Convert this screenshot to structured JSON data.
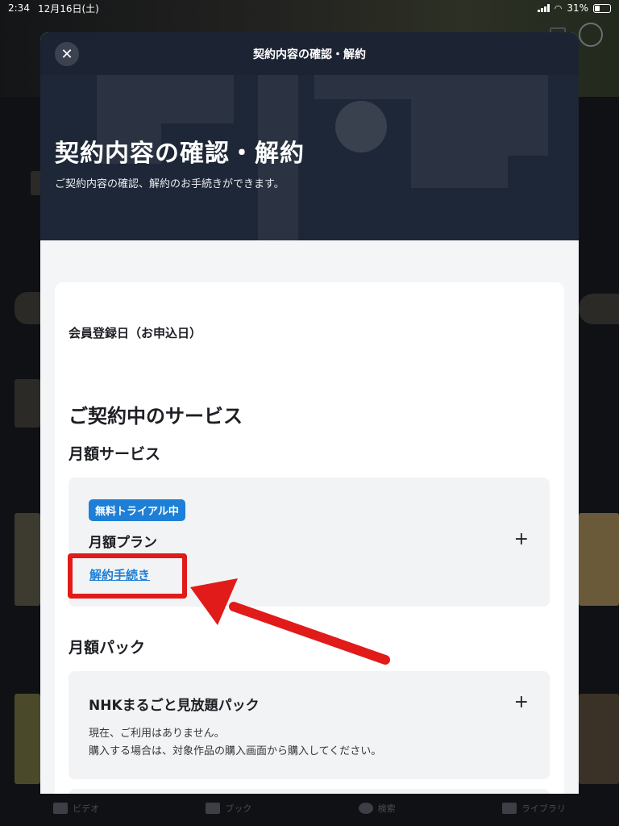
{
  "status_bar": {
    "time": "2:34",
    "date": "12月16日(土)",
    "battery": "31%"
  },
  "modal": {
    "header_title": "契約内容の確認・解約",
    "close_icon": "close-icon",
    "hero_title": "契約内容の確認・解約",
    "hero_subtitle": "ご契約内容の確認、解約のお手続きができます。",
    "member_registration_label": "会員登録日（お申込日）",
    "services_heading": "ご契約中のサービス",
    "monthly_service_heading": "月額サービス",
    "monthly_plan": {
      "badge": "無料トライアル中",
      "name": "月額プラン",
      "cancel_link": "解約手続き",
      "expand_symbol": "+"
    },
    "monthly_pack_heading": "月額パック",
    "pack": {
      "name": "NHKまるごと見放題パック",
      "expand_symbol": "+",
      "note_line1": "現在、ご利用はありません。",
      "note_line2": "購入する場合は、対象作品の購入画面から購入してください。"
    }
  },
  "background_tabs": [
    "ビデオ",
    "ブック",
    "検索",
    "ライブラリ"
  ],
  "annotation": {
    "highlight_color": "#e11a1a"
  }
}
